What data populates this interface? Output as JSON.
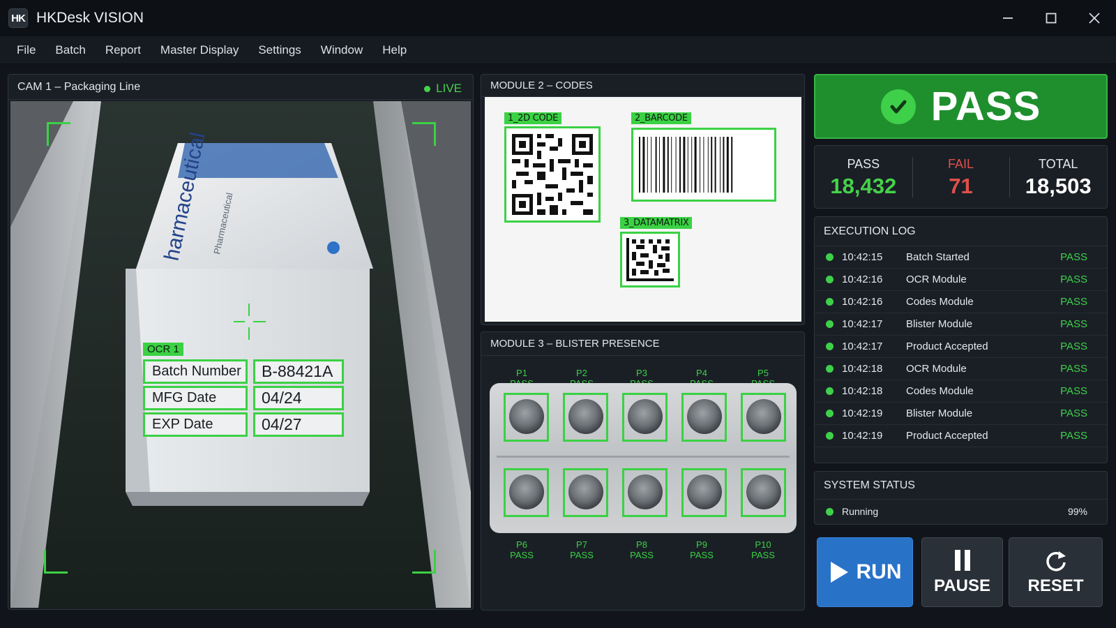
{
  "app": {
    "logo": "HK",
    "title": "HKDesk VISION"
  },
  "menu": [
    "File",
    "Batch",
    "Report",
    "Master Display",
    "Settings",
    "Window",
    "Help"
  ],
  "camera": {
    "title": "CAM 1 – Packaging Line",
    "live_label": "LIVE",
    "box_print": "harmaceutical",
    "box_print_sub": "Pharmaceutical",
    "ocr_tag": "OCR 1",
    "ocr_rows": [
      {
        "label": "Batch Number",
        "value": "B-88421A"
      },
      {
        "label": "MFG Date",
        "value": "04/24"
      },
      {
        "label": "EXP Date",
        "value": "04/27"
      }
    ]
  },
  "codes": {
    "title": "MODULE 2 – CODES",
    "labels": {
      "qr": "1_2D CODE",
      "barcode": "2_BARCODE",
      "datamatrix": "3_DATAMATRIX"
    }
  },
  "blister": {
    "title": "MODULE 3 – BLISTER PRESENCE",
    "top": [
      {
        "id": "P1",
        "status": "PASS"
      },
      {
        "id": "P2",
        "status": "PASS"
      },
      {
        "id": "P3",
        "status": "PASS"
      },
      {
        "id": "P4",
        "status": "PASS"
      },
      {
        "id": "P5",
        "status": "PASS"
      }
    ],
    "bottom": [
      {
        "id": "P6",
        "status": "PASS"
      },
      {
        "id": "P7",
        "status": "PASS"
      },
      {
        "id": "P8",
        "status": "PASS"
      },
      {
        "id": "P9",
        "status": "PASS"
      },
      {
        "id": "P10",
        "status": "PASS"
      }
    ]
  },
  "result": {
    "label": "PASS",
    "color": "#1f8f2d"
  },
  "stats": [
    {
      "label": "PASS",
      "value": "18,432",
      "label_color": "#e5e8ec",
      "value_color": "#47d14a"
    },
    {
      "label": "FAIL",
      "value": "71",
      "label_color": "#e0504a",
      "value_color": "#e0504a"
    },
    {
      "label": "TOTAL",
      "value": "18,503",
      "label_color": "#e5e8ec",
      "value_color": "#ffffff"
    }
  ],
  "log": {
    "title": "EXECUTION LOG",
    "rows": [
      {
        "time": "10:42:15",
        "event": "Batch Started",
        "status": "PASS"
      },
      {
        "time": "10:42:16",
        "event": "OCR Module",
        "status": "PASS"
      },
      {
        "time": "10:42:16",
        "event": "Codes Module",
        "status": "PASS"
      },
      {
        "time": "10:42:17",
        "event": "Blister Module",
        "status": "PASS"
      },
      {
        "time": "10:42:17",
        "event": "Product Accepted",
        "status": "PASS"
      },
      {
        "time": "10:42:18",
        "event": "OCR Module",
        "status": "PASS"
      },
      {
        "time": "10:42:18",
        "event": "Codes Module",
        "status": "PASS"
      },
      {
        "time": "10:42:19",
        "event": "Blister Module",
        "status": "PASS"
      },
      {
        "time": "10:42:19",
        "event": "Product Accepted",
        "status": "PASS"
      }
    ]
  },
  "system": {
    "title": "SYSTEM STATUS",
    "state": "Running",
    "percent": "99%"
  },
  "controls": {
    "run": "RUN",
    "pause": "PAUSE",
    "reset": "RESET"
  },
  "icons": {
    "minimize": "minimize-icon",
    "maximize": "maximize-icon",
    "close": "close-icon",
    "check": "check-icon",
    "play": "play-icon",
    "pause": "pause-icon",
    "reset": "refresh-icon"
  },
  "colors": {
    "accent_green": "#3bd144",
    "run_blue": "#2872c8",
    "fail_red": "#e0504a"
  }
}
